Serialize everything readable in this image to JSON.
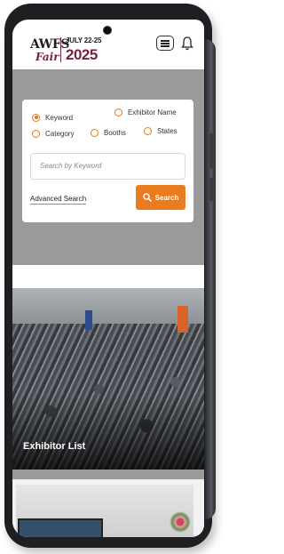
{
  "header": {
    "logo": {
      "brand": "AWFS",
      "sub": "Fair",
      "dates": "JULY 22-25",
      "year": "2025"
    },
    "menu_icon": "hamburger-icon",
    "notification_icon": "bell-icon"
  },
  "search": {
    "options": [
      {
        "label": "Keyword",
        "checked": true
      },
      {
        "label": "Exhibitor Name",
        "checked": false
      },
      {
        "label": "Category",
        "checked": false
      },
      {
        "label": "Booths",
        "checked": false
      },
      {
        "label": "States",
        "checked": false
      }
    ],
    "input": {
      "placeholder": "Search by Keyword",
      "value": ""
    },
    "advanced_label": "Advanced Search",
    "button_label": "Search",
    "accent_color": "#e87c1e"
  },
  "banner": {
    "title": "Exhibitor List"
  }
}
